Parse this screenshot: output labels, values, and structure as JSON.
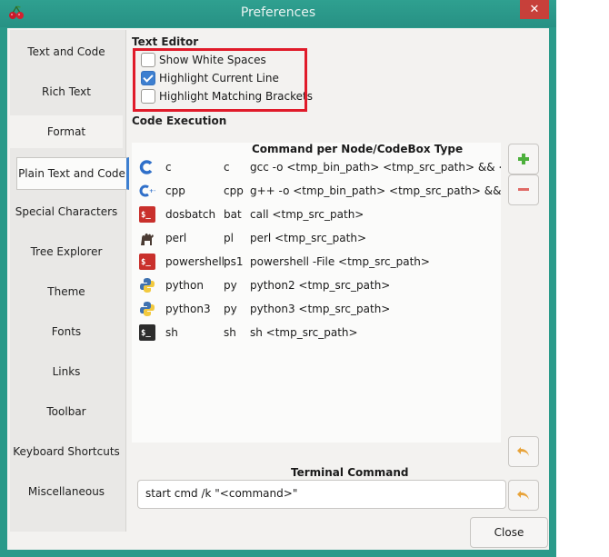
{
  "window": {
    "title": "Preferences"
  },
  "sidebar": {
    "items": [
      {
        "label": "Text and Code"
      },
      {
        "label": "Rich Text"
      },
      {
        "label": "Format"
      },
      {
        "label": "Plain Text and Code"
      },
      {
        "label": "Special Characters"
      },
      {
        "label": "Tree Explorer"
      },
      {
        "label": "Theme"
      },
      {
        "label": "Fonts"
      },
      {
        "label": "Links"
      },
      {
        "label": "Toolbar"
      },
      {
        "label": "Keyboard Shortcuts"
      },
      {
        "label": "Miscellaneous"
      }
    ]
  },
  "text_editor": {
    "title": "Text Editor",
    "options": [
      {
        "label": "Show White Spaces",
        "checked": false
      },
      {
        "label": "Highlight Current Line",
        "checked": true
      },
      {
        "label": "Highlight Matching Brackets",
        "checked": false
      }
    ]
  },
  "code_execution": {
    "title": "Code Execution",
    "column_header": "Command per Node/CodeBox Type",
    "rows": [
      {
        "icon": "c-lang-icon",
        "name": "c",
        "ext": "c",
        "cmd": "gcc -o <tmp_bin_path> <tmp_src_path> && <tmp_bi"
      },
      {
        "icon": "cpp-lang-icon",
        "name": "cpp",
        "ext": "cpp",
        "cmd": "g++ -o <tmp_bin_path> <tmp_src_path> && <tmp_b"
      },
      {
        "icon": "terminal-red-icon",
        "name": "dosbatch",
        "ext": "bat",
        "cmd": "call <tmp_src_path>"
      },
      {
        "icon": "camel-icon",
        "name": "perl",
        "ext": "pl",
        "cmd": "perl <tmp_src_path>"
      },
      {
        "icon": "terminal-red-icon",
        "name": "powershell",
        "ext": "ps1",
        "cmd": "powershell -File <tmp_src_path>"
      },
      {
        "icon": "python-icon",
        "name": "python",
        "ext": "py",
        "cmd": "python2 <tmp_src_path>"
      },
      {
        "icon": "python-icon",
        "name": "python3",
        "ext": "py",
        "cmd": "python3 <tmp_src_path>"
      },
      {
        "icon": "terminal-dark-icon",
        "name": "sh",
        "ext": "sh",
        "cmd": "sh <tmp_src_path>"
      }
    ]
  },
  "terminal": {
    "label": "Terminal Command",
    "value": "start cmd /k \"<command>\""
  },
  "buttons": {
    "close": "Close"
  },
  "colors": {
    "accent": "#3d7fd0",
    "highlight_box": "#e01b2a",
    "titlebar": "#2a9a8a",
    "add": "#4caf3c",
    "remove": "#d9534f",
    "undo": "#e8a33a"
  }
}
